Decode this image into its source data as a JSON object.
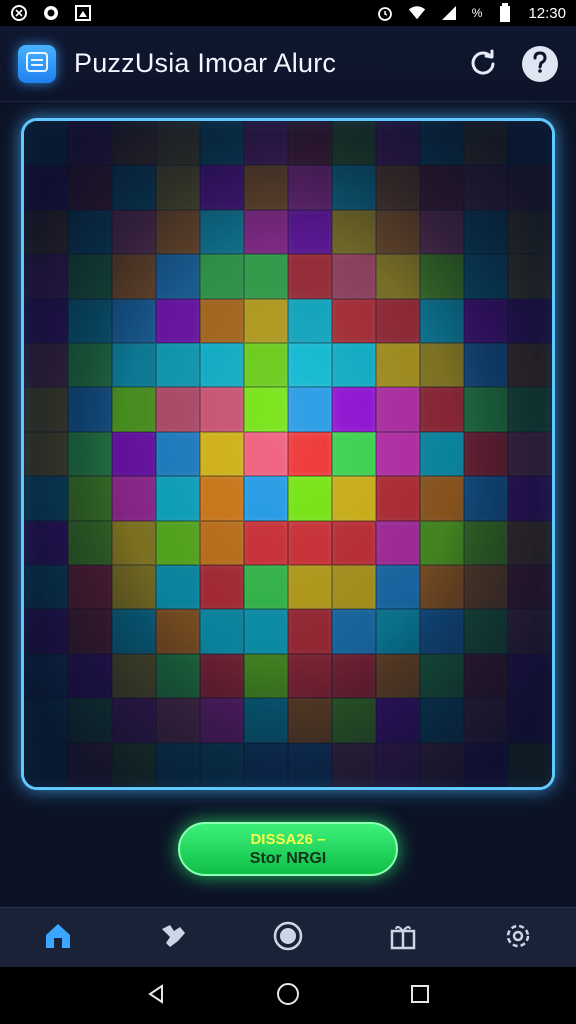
{
  "status_bar": {
    "time": "12:30",
    "battery_text": "%"
  },
  "header": {
    "title": "PuzzUsia Imoar Alurc",
    "menu_icon": "menu-icon",
    "refresh_icon": "refresh-icon",
    "help_icon": "help-icon"
  },
  "board": {
    "palette": [
      "#ff2a2a",
      "#ff8a00",
      "#ffd500",
      "#3dff4a",
      "#00e6ff",
      "#ff2bd6",
      "#b000ff",
      "#1aa7ff",
      "#7cff00",
      "#ff5a7a"
    ]
  },
  "action_button": {
    "line1": "DISSA26 –",
    "line2": "Stor NRGI"
  },
  "bottom_nav": {
    "items": [
      "home-icon",
      "dinosaur-icon",
      "record-icon",
      "gift-icon",
      "settings-icon"
    ],
    "active_color": "#3aa6ff",
    "inactive_color": "#cdd5e6"
  },
  "system_nav": {
    "items": [
      "back-icon",
      "home-circle-icon",
      "recents-icon"
    ]
  },
  "colors": {
    "accent": "#5ec8ff",
    "button_green": "#1fd35a",
    "background": "#0c1326"
  }
}
